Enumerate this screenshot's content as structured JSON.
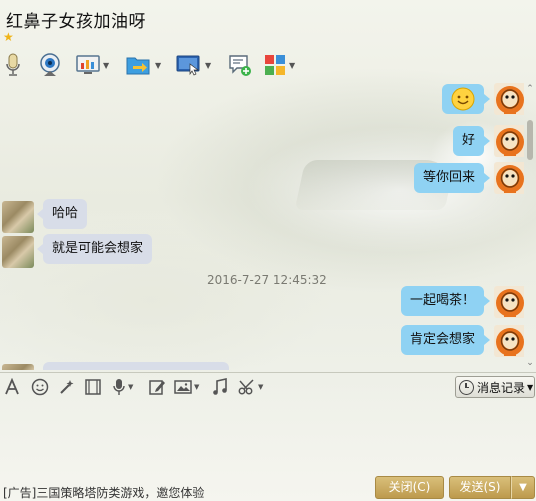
{
  "window": {
    "title": "红鼻子女孩加油呀",
    "star": "★"
  },
  "messages": [
    {
      "side": "me",
      "type": "emoji",
      "text": "😊"
    },
    {
      "side": "me",
      "type": "text",
      "text": "好"
    },
    {
      "side": "me",
      "type": "text",
      "text": "等你回来"
    },
    {
      "side": "other",
      "type": "text",
      "text": "哈哈"
    },
    {
      "side": "other",
      "type": "text",
      "text": "就是可能会想家"
    },
    {
      "side": "system",
      "type": "timestamp",
      "text": "2016-7-27 12:45:32"
    },
    {
      "side": "me",
      "type": "text",
      "text": "一起喝茶！"
    },
    {
      "side": "me",
      "type": "text",
      "text": "肯定会想家"
    }
  ],
  "input_toolbar": {
    "history_label": "消息记录"
  },
  "footer": {
    "ad_text": "[广告]三国策略塔防类游戏，邀您体验",
    "close_label": "关闭(C)",
    "send_label": "发送(S)"
  },
  "colors": {
    "my_bubble": "#8fd2f3",
    "other_bubble": "#d8dde8",
    "button_gold": "#c8a95e",
    "star": "#f0b418"
  }
}
